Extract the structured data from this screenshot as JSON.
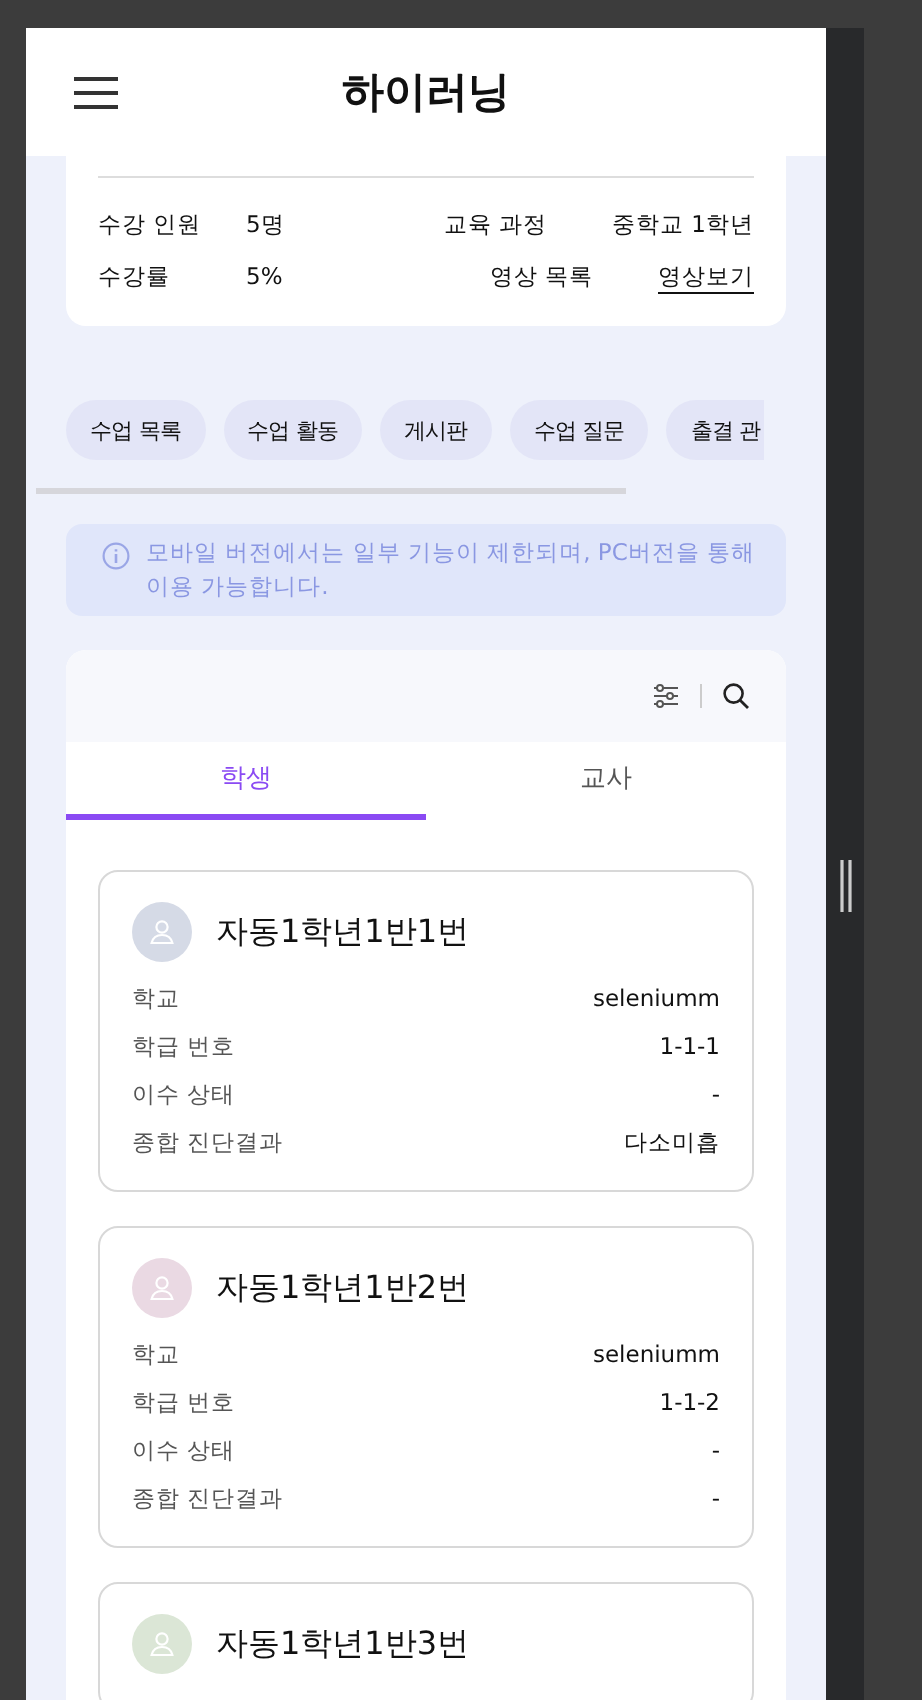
{
  "header": {
    "title": "하이러닝"
  },
  "course_info": {
    "rows": [
      {
        "kind": "text",
        "label": "수강 인원",
        "value": "5명",
        "label_2": "교육 과정",
        "value_2": "중학교 1학년"
      },
      {
        "kind": "link",
        "label": "수강률",
        "value": "5%",
        "label_2": "영상 목록",
        "value_2": "영상보기"
      }
    ]
  },
  "chips": [
    "수업 목록",
    "수업 활동",
    "게시판",
    "수업 질문",
    "출결 관"
  ],
  "notice": "모바일 버전에서는 일부 기능이 제한되며, PC버전을 통해 이용 가능합니다.",
  "tabs": [
    {
      "label": "학생",
      "selected": true
    },
    {
      "label": "교사",
      "selected": false
    }
  ],
  "students": [
    {
      "name": "자동1학년1반1번",
      "color": "#d5dae6",
      "fields": [
        {
          "label": "학교",
          "value": "seleniumm"
        },
        {
          "label": "학급 번호",
          "value": "1-1-1"
        },
        {
          "label": "이수 상태",
          "value": "-"
        },
        {
          "label": "종합 진단결과",
          "value": "다소미흡"
        }
      ]
    },
    {
      "name": "자동1학년1반2번",
      "color": "#ead9e3",
      "fields": [
        {
          "label": "학교",
          "value": "seleniumm"
        },
        {
          "label": "학급 번호",
          "value": "1-1-2"
        },
        {
          "label": "이수 상태",
          "value": "-"
        },
        {
          "label": "종합 진단결과",
          "value": "-"
        }
      ]
    },
    {
      "name": "자동1학년1반3번",
      "color": "#dbe6d6"
    }
  ]
}
